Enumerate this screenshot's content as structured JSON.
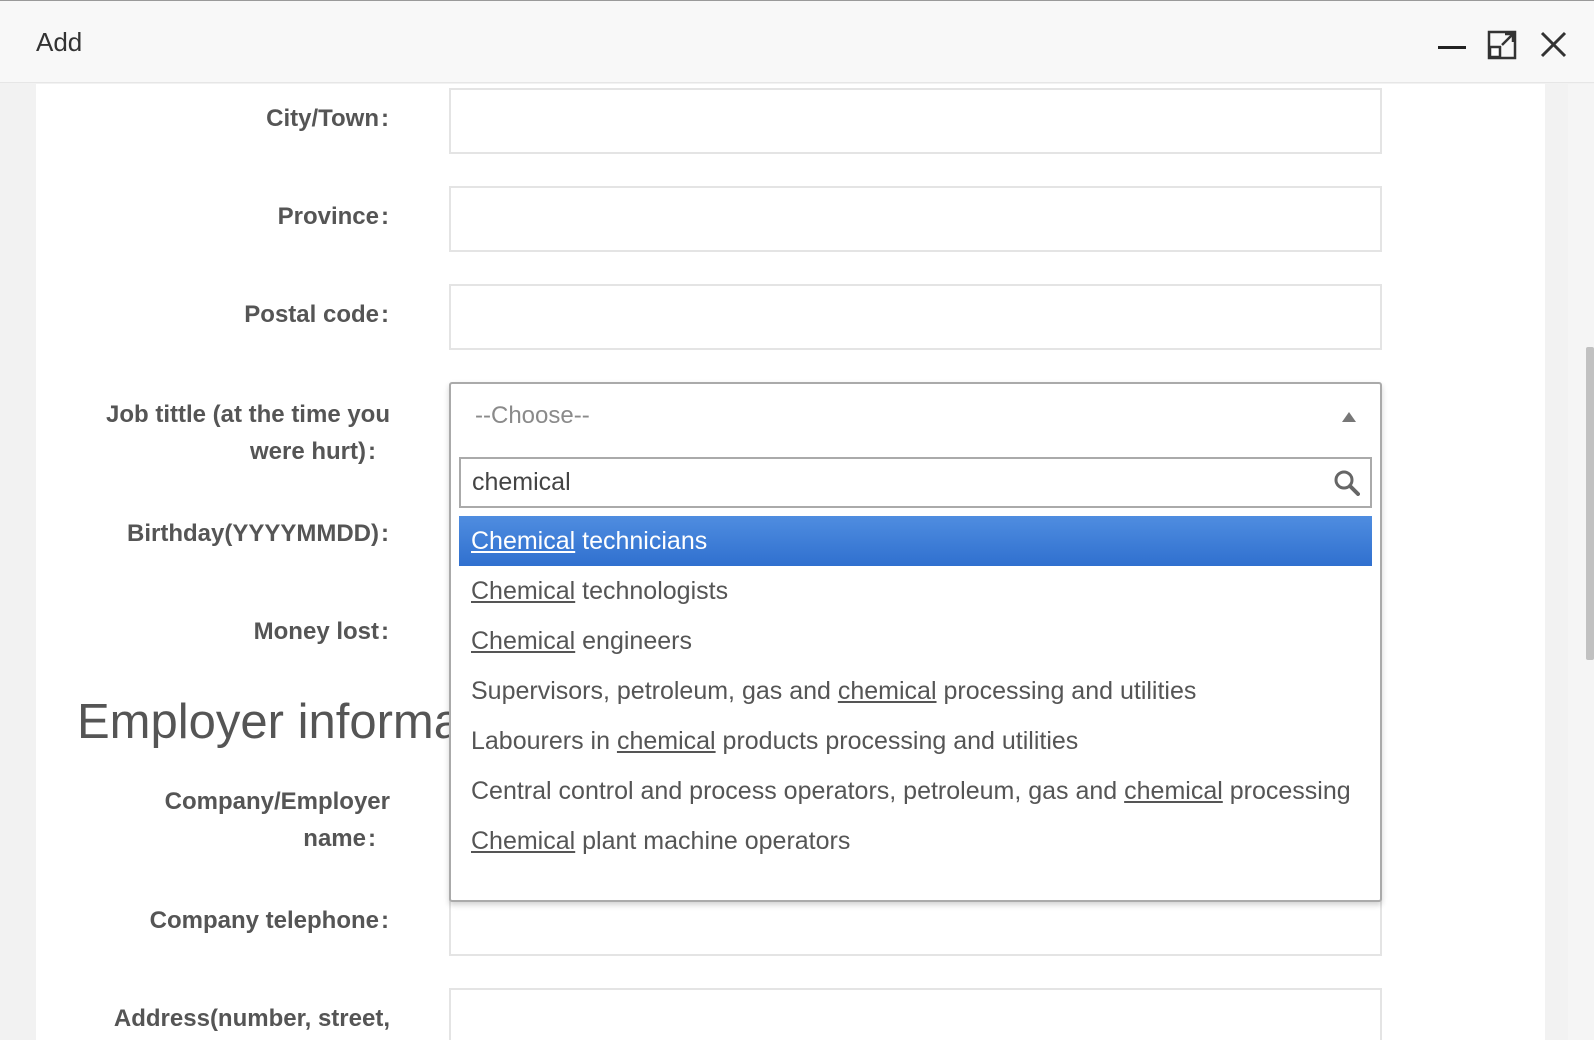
{
  "window": {
    "title": "Add",
    "controls": [
      "minimize-icon",
      "maximize-icon",
      "close-icon"
    ]
  },
  "form": {
    "colon": ":",
    "labels": {
      "city": "City/Town",
      "province": "Province",
      "postal": "Postal code",
      "job_line1": "Job tittle (at the time you",
      "job_line2": "were hurt)",
      "birthday": "Birthday(YYYYMMDD)",
      "money": "Money lost",
      "company_line1": "Company/Employer",
      "company_line2": "name",
      "telephone": "Company telephone",
      "address": "Address(number, street,"
    },
    "section_heading": "Employer informa"
  },
  "job_select": {
    "selected": "--Choose--",
    "search_value": "chemical",
    "search_placeholder": "",
    "options": [
      {
        "match": "Chemical",
        "before": "",
        "after": " technicians",
        "highlighted": true
      },
      {
        "match": "Chemical",
        "before": "",
        "after": " technologists",
        "highlighted": false
      },
      {
        "match": "Chemical",
        "before": "",
        "after": " engineers",
        "highlighted": false
      },
      {
        "match": "chemical",
        "before": "Supervisors, petroleum, gas and ",
        "after": " processing and utilities",
        "highlighted": false
      },
      {
        "match": "chemical",
        "before": "Labourers in ",
        "after": " products processing and utilities",
        "highlighted": false
      },
      {
        "match": "chemical",
        "before": "Central control and process operators, petroleum, gas and ",
        "after": " processing",
        "highlighted": false
      },
      {
        "match": "Chemical",
        "before": "",
        "after": " plant machine operators",
        "highlighted": false
      }
    ]
  },
  "colors": {
    "highlight": "#3a7bd5",
    "panel_bg": "#ffffff",
    "page_bg": "#f2f2f2"
  }
}
